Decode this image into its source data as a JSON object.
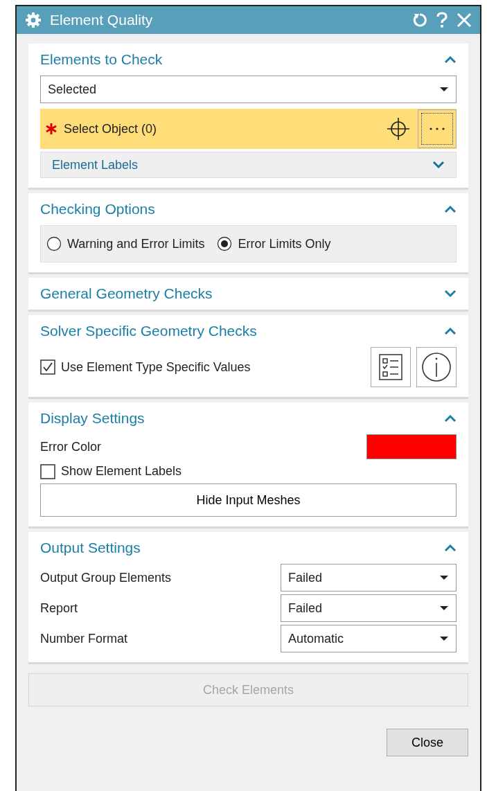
{
  "window": {
    "title": "Element Quality"
  },
  "sections": [
    {
      "kind": "elements",
      "title": "Elements to Check",
      "expanded": true,
      "dropdown": {
        "value": "Selected"
      },
      "selection": {
        "label": "Select Object (0)",
        "required": true
      },
      "subgroup": {
        "title": "Element Labels",
        "expanded": false
      }
    },
    {
      "kind": "options",
      "title": "Checking Options",
      "expanded": true,
      "radios": [
        {
          "label": "Warning and Error Limits",
          "selected": false
        },
        {
          "label": "Error Limits Only",
          "selected": true
        }
      ]
    },
    {
      "title": "General Geometry Checks",
      "expanded": false
    },
    {
      "kind": "solver",
      "title": "Solver Specific Geometry Checks",
      "expanded": true,
      "checkbox": {
        "label": "Use Element Type Specific Values",
        "checked": true
      }
    },
    {
      "kind": "display",
      "title": "Display Settings",
      "expanded": true,
      "swatch": {
        "label": "Error Color",
        "color": "#ff0000"
      },
      "checkbox": {
        "label": "Show Element Labels",
        "checked": false
      },
      "button": "Hide Input Meshes"
    },
    {
      "kind": "output",
      "title": "Output Settings",
      "expanded": true,
      "fields": [
        {
          "label": "Output Group Elements",
          "value": "Failed"
        },
        {
          "label": "Report",
          "value": "Failed"
        },
        {
          "label": "Number Format",
          "value": "Automatic"
        }
      ]
    }
  ],
  "action_button": {
    "label": "Check Elements",
    "disabled": true
  },
  "close_button": "Close"
}
